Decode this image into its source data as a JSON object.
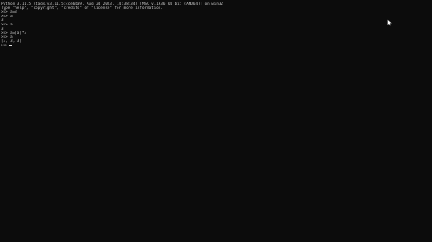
{
  "terminal": {
    "lines": [
      "Python 3.11.5 (tags/v3.11.5:cce6ba9, Aug 24 2023, 14:38:34) [MSC v.1936 64 bit (AMD64)] on win32",
      "Type \"help\", \"copyright\", \"credits\" or \"license\" for more information.",
      ">>> a=3",
      ">>> a",
      "3",
      ">>> a",
      "3",
      ">>> a=[a]*3",
      ">>> a",
      "[3, 3, 3]",
      ">>>"
    ]
  }
}
